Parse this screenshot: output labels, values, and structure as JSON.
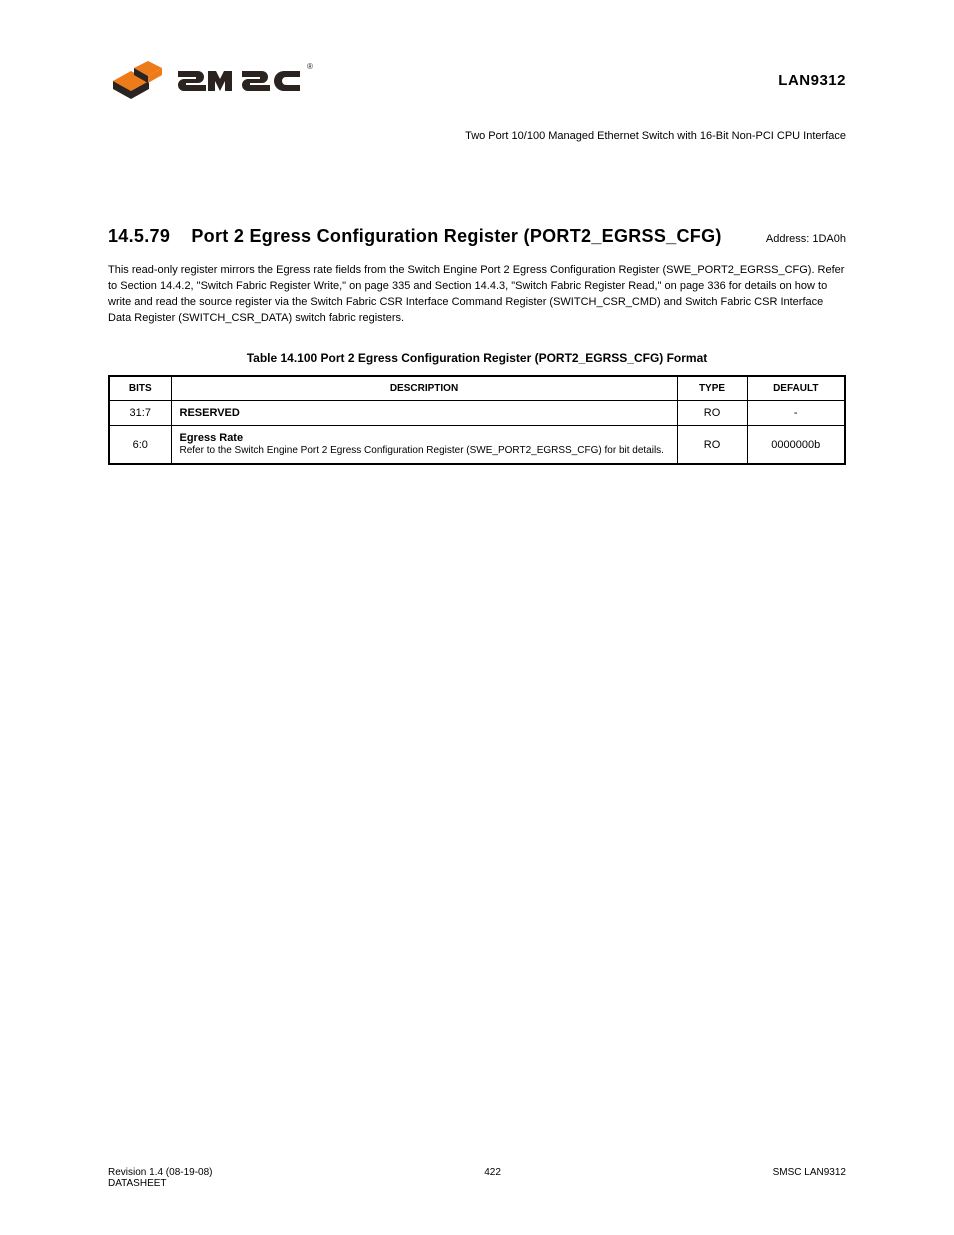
{
  "header": {
    "doc_id": "LAN9312",
    "subtitle": "Two Port 10/100 Managed Ethernet Switch with 16-Bit Non-PCI CPU Interface"
  },
  "section": {
    "number": "14.5.79",
    "title": "Port 2 Egress Configuration Register (PORT2_EGRSS_CFG)"
  },
  "paragraphs": {
    "p1": "This read-only register mirrors the Egress rate fields from the Switch Engine Port 2 Egress Configuration Register (SWE_PORT2_EGRSS_CFG). Refer to Section 14.4.2, \"Switch Fabric Register Write,\" on page 335 and Section 14.4.3, \"Switch Fabric Register Read,\" on page 336 for details on how to write and read the source register via the Switch Fabric CSR Interface Command Register (SWITCH_CSR_CMD) and Switch Fabric CSR Interface Data Register (SWITCH_CSR_DATA) switch fabric registers."
  },
  "table": {
    "caption": "Table 14.100 Port 2 Egress Configuration Register (PORT2_EGRSS_CFG) Format",
    "headers": [
      "BITS",
      "DESCRIPTION",
      "TYPE",
      "DEFAULT"
    ],
    "rows": [
      {
        "bits": "31:7",
        "desc_bold": "RESERVED",
        "desc_sub": "",
        "type": "RO",
        "def": "-"
      },
      {
        "bits": "6:0",
        "desc_bold": "Egress Rate",
        "desc_sub": "Refer to the Switch Engine Port 2 Egress Configuration Register (SWE_PORT2_EGRSS_CFG) for bit details.",
        "type": "RO",
        "def": "0000000b"
      }
    ]
  },
  "address": {
    "label": "Address:",
    "value": "1DA0h"
  },
  "footer": {
    "left_line1": "Revision 1.4 (08-19-08)",
    "left_line2": "DATASHEET",
    "center": "422",
    "right": "SMSC LAN9312"
  }
}
